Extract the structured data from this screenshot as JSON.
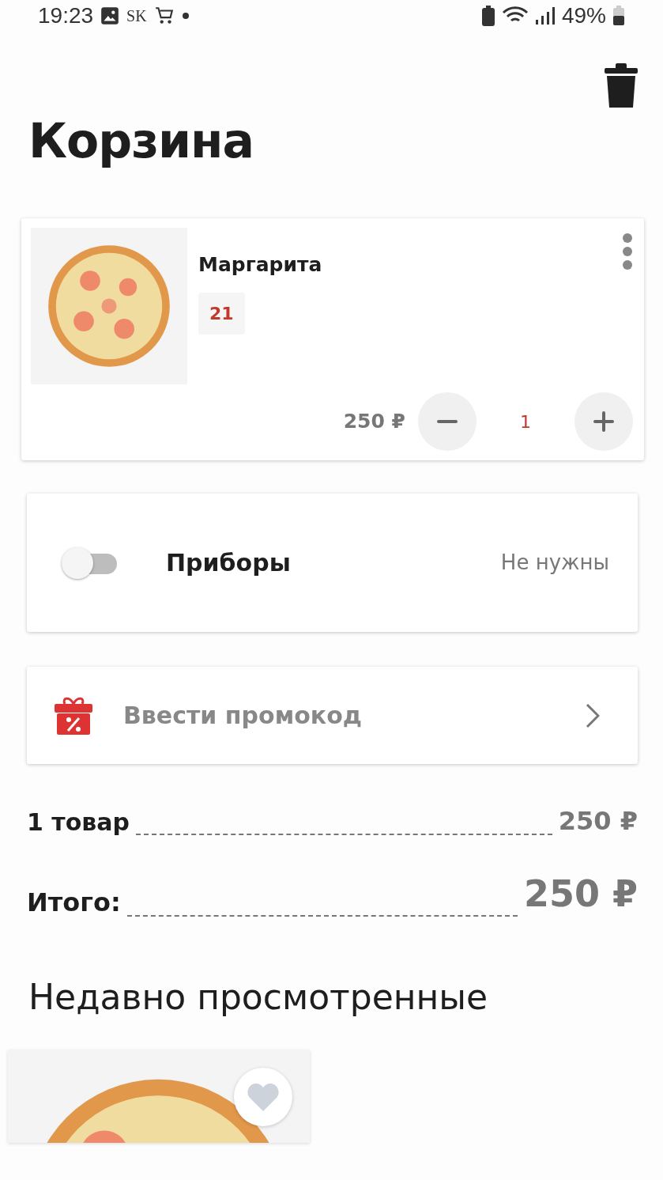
{
  "status_bar": {
    "time": "19:23",
    "carrier": "SK",
    "battery": "49%"
  },
  "title": "Корзина",
  "cart_items": [
    {
      "name": "Маргарита",
      "tag": "21",
      "price": "250 ₽",
      "quantity": "1"
    }
  ],
  "cutlery": {
    "label": "Приборы",
    "value": "Не нужны",
    "on": false
  },
  "promo": {
    "label": "Ввести промокод"
  },
  "summary": [
    {
      "kind": "count",
      "label": "1 товар",
      "amount": "250 ₽"
    },
    {
      "kind": "total",
      "label": "Итого:",
      "amount": "250 ₽"
    }
  ],
  "recent": {
    "title": "Недавно просмотренные",
    "items": [
      {
        "favorite": false
      }
    ]
  }
}
